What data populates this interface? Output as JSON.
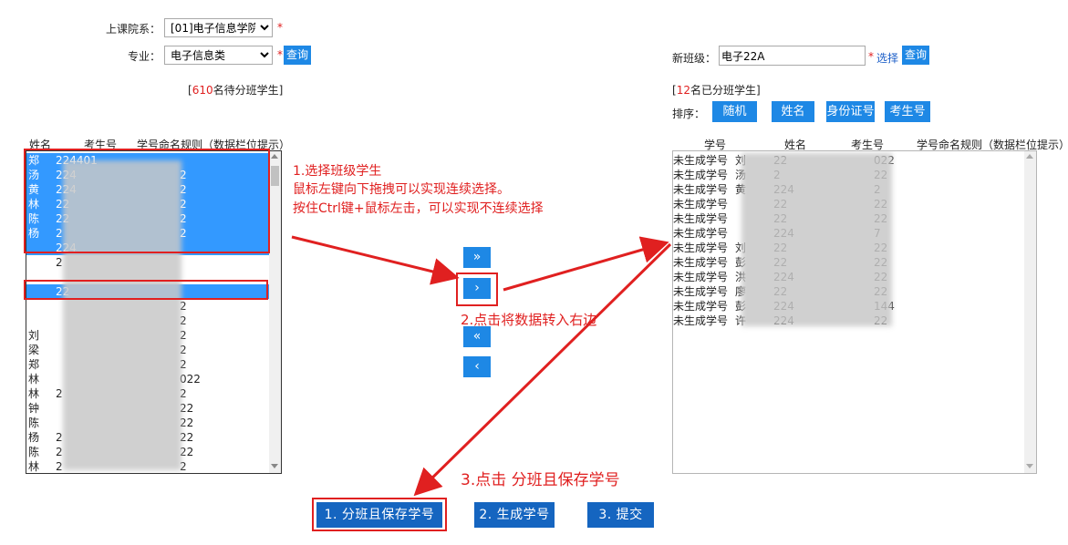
{
  "form": {
    "department_label": "上课院系：",
    "department_value": "[01]电子信息学院",
    "major_label": "专业：",
    "major_value": "电子信息类",
    "required_mark": "*",
    "query_label": "查询",
    "new_class_label": "新班级：",
    "new_class_value": "电子22A",
    "choose_label": "选择"
  },
  "left_list": {
    "count_open": "[",
    "count_num": "610",
    "count_text": "名待分班学生]",
    "headers": [
      "姓名",
      "考生号",
      "学号命名规则（数据栏位提示）"
    ],
    "rows": [
      {
        "a": "郑",
        "b": "224401",
        "c": ""
      },
      {
        "a": "汤",
        "b": "224",
        "c": "2"
      },
      {
        "a": "黄",
        "b": "224",
        "c": "2"
      },
      {
        "a": "林",
        "b": "22",
        "c": "2"
      },
      {
        "a": "陈",
        "b": "22",
        "c": "2"
      },
      {
        "a": "杨",
        "b": "2",
        "c": "2"
      },
      {
        "a": "",
        "b": "224",
        "c": ""
      },
      {
        "a": "",
        "b": "2",
        "c": ""
      },
      {
        "a": "",
        "b": "",
        "c": ""
      },
      {
        "a": "",
        "b": "22",
        "c": ""
      },
      {
        "a": "",
        "b": "",
        "c": "2"
      },
      {
        "a": "",
        "b": "",
        "c": "2"
      },
      {
        "a": "刘",
        "b": "",
        "c": "2"
      },
      {
        "a": "梁",
        "b": "",
        "c": "2"
      },
      {
        "a": "郑",
        "b": "",
        "c": "2"
      },
      {
        "a": "林",
        "b": "",
        "c": "022"
      },
      {
        "a": "林",
        "b": "2",
        "c": "2"
      },
      {
        "a": "钟",
        "b": "",
        "c": "22"
      },
      {
        "a": "陈",
        "b": "",
        "c": "22"
      },
      {
        "a": "杨",
        "b": "2",
        "c": "22"
      },
      {
        "a": "陈",
        "b": "2",
        "c": "22"
      },
      {
        "a": "林",
        "b": "2",
        "c": "2"
      }
    ]
  },
  "right_list": {
    "count_open": "[",
    "count_num": "12",
    "count_text": "名已分班学生]",
    "sort_label": "排序：",
    "sort_buttons": [
      "随机",
      "姓名",
      "身份证号",
      "考生号"
    ],
    "headers": [
      "学号",
      "姓名",
      "考生号",
      "学号命名规则（数据栏位提示）"
    ],
    "rows": [
      {
        "a": "未生成学号",
        "b": "刘",
        "c": "22",
        "d": "022"
      },
      {
        "a": "未生成学号",
        "b": "汤",
        "c": "2",
        "d": "22"
      },
      {
        "a": "未生成学号",
        "b": "黄",
        "c": "224",
        "d": "2"
      },
      {
        "a": "未生成学号",
        "b": "",
        "c": "22",
        "d": "22"
      },
      {
        "a": "未生成学号",
        "b": "",
        "c": "22",
        "d": "22"
      },
      {
        "a": "未生成学号",
        "b": "",
        "c": "224",
        "d": "7"
      },
      {
        "a": "未生成学号",
        "b": "刘",
        "c": "22",
        "d": "22"
      },
      {
        "a": "未生成学号",
        "b": "彭",
        "c": "22",
        "d": "22"
      },
      {
        "a": "未生成学号",
        "b": "洪",
        "c": "224",
        "d": "22"
      },
      {
        "a": "未生成学号",
        "b": "廖",
        "c": "22",
        "d": "22"
      },
      {
        "a": "未生成学号",
        "b": "彭",
        "c": "224",
        "d": "144"
      },
      {
        "a": "未生成学号",
        "b": "许",
        "c": "224",
        "d": "22"
      }
    ]
  },
  "move_buttons": {
    "all_right": "»",
    "right": "›",
    "all_left": "«",
    "left": "‹"
  },
  "actions": {
    "save_label": "1. 分班且保存学号",
    "generate_label": "2. 生成学号",
    "submit_label": "3. 提交"
  },
  "annotations": {
    "step1_line1": "1.选择班级学生",
    "step1_line2": "鼠标左键向下拖拽可以实现连续选择。",
    "step1_line3": "按住Ctrl键+鼠标左击，可以实现不连续选择",
    "step2": "2.点击将数据转入右边",
    "step3": "3.点击 分班且保存学号"
  },
  "colors": {
    "accent": "#1e88e5",
    "selection": "#3399ff",
    "annotation": "#e02020"
  }
}
